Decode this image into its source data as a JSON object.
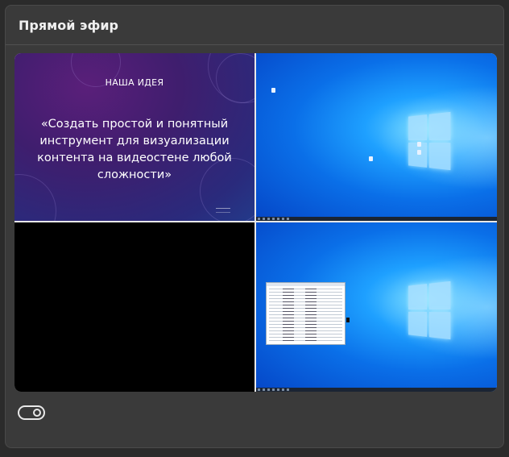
{
  "panel": {
    "title": "Прямой эфир"
  },
  "videowall": {
    "slide": {
      "heading": "НАША ИДЕЯ",
      "quote": "«Создать простой и понятный инструмент для визуализации контента на видеостене любой сложности»"
    }
  },
  "toggle": {
    "state": "on",
    "icon": "toggle-icon"
  },
  "colors": {
    "panel_bg": "#3a3a3a",
    "page_bg": "#2b2b2b",
    "text": "#f0f0f0"
  }
}
